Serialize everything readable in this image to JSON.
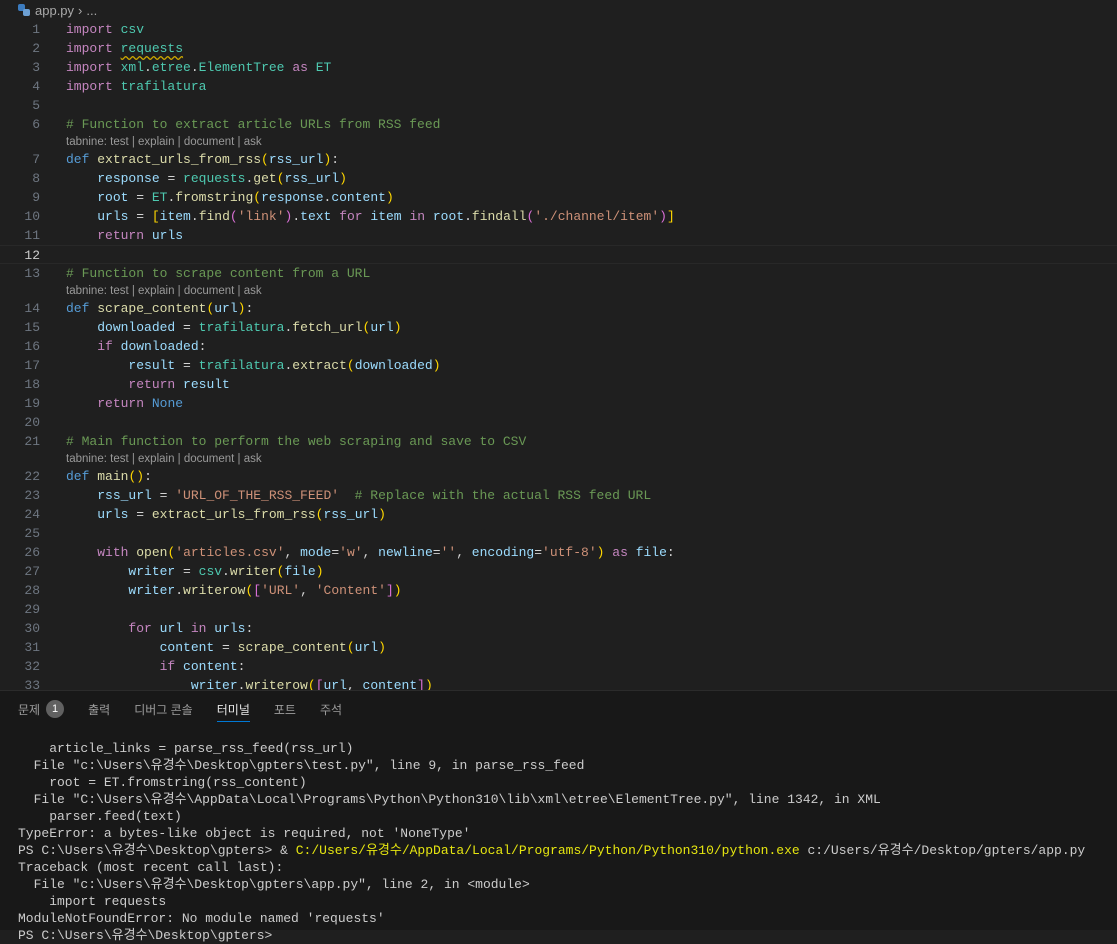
{
  "breadcrumb": {
    "file": "app.py",
    "more": "..."
  },
  "codelens": "tabnine: test | explain | document | ask",
  "current_line": 12,
  "code": [
    {
      "n": 1,
      "t": [
        [
          "k",
          "import"
        ],
        [
          "p",
          " "
        ],
        [
          "m",
          "csv"
        ]
      ]
    },
    {
      "n": 2,
      "t": [
        [
          "k",
          "import"
        ],
        [
          "p",
          " "
        ],
        [
          "m sq",
          "requests"
        ]
      ]
    },
    {
      "n": 3,
      "t": [
        [
          "k",
          "import"
        ],
        [
          "p",
          " "
        ],
        [
          "m",
          "xml"
        ],
        [
          "p",
          "."
        ],
        [
          "m",
          "etree"
        ],
        [
          "p",
          "."
        ],
        [
          "m",
          "ElementTree"
        ],
        [
          "p",
          " "
        ],
        [
          "k",
          "as"
        ],
        [
          "p",
          " "
        ],
        [
          "m",
          "ET"
        ]
      ]
    },
    {
      "n": 4,
      "t": [
        [
          "k",
          "import"
        ],
        [
          "p",
          " "
        ],
        [
          "m",
          "trafilatura"
        ]
      ]
    },
    {
      "n": 5,
      "t": []
    },
    {
      "n": 6,
      "t": [
        [
          "c",
          "# Function to extract article URLs from RSS feed"
        ]
      ]
    },
    {
      "n": 7,
      "lens": true,
      "t": [
        [
          "d",
          "def"
        ],
        [
          "p",
          " "
        ],
        [
          "f",
          "extract_urls_from_rss"
        ],
        [
          "b1",
          "("
        ],
        [
          "v",
          "rss_url"
        ],
        [
          "b1",
          ")"
        ],
        [
          "p",
          ":"
        ]
      ]
    },
    {
      "n": 8,
      "t": [
        [
          "p",
          "    "
        ],
        [
          "v",
          "response"
        ],
        [
          "p",
          " = "
        ],
        [
          "m",
          "requests"
        ],
        [
          "p",
          "."
        ],
        [
          "f",
          "get"
        ],
        [
          "b1",
          "("
        ],
        [
          "v",
          "rss_url"
        ],
        [
          "b1",
          ")"
        ]
      ]
    },
    {
      "n": 9,
      "t": [
        [
          "p",
          "    "
        ],
        [
          "v",
          "root"
        ],
        [
          "p",
          " = "
        ],
        [
          "m",
          "ET"
        ],
        [
          "p",
          "."
        ],
        [
          "f",
          "fromstring"
        ],
        [
          "b1",
          "("
        ],
        [
          "v",
          "response"
        ],
        [
          "p",
          "."
        ],
        [
          "v",
          "content"
        ],
        [
          "b1",
          ")"
        ]
      ]
    },
    {
      "n": 10,
      "t": [
        [
          "p",
          "    "
        ],
        [
          "v",
          "urls"
        ],
        [
          "p",
          " = "
        ],
        [
          "b1",
          "["
        ],
        [
          "v",
          "item"
        ],
        [
          "p",
          "."
        ],
        [
          "f",
          "find"
        ],
        [
          "b2",
          "("
        ],
        [
          "s",
          "'link'"
        ],
        [
          "b2",
          ")"
        ],
        [
          "p",
          "."
        ],
        [
          "v",
          "text"
        ],
        [
          "p",
          " "
        ],
        [
          "k",
          "for"
        ],
        [
          "p",
          " "
        ],
        [
          "v",
          "item"
        ],
        [
          "p",
          " "
        ],
        [
          "k",
          "in"
        ],
        [
          "p",
          " "
        ],
        [
          "v",
          "root"
        ],
        [
          "p",
          "."
        ],
        [
          "f",
          "findall"
        ],
        [
          "b2",
          "("
        ],
        [
          "s",
          "'./channel/item'"
        ],
        [
          "b2",
          ")"
        ],
        [
          "b1",
          "]"
        ]
      ]
    },
    {
      "n": 11,
      "t": [
        [
          "p",
          "    "
        ],
        [
          "k",
          "return"
        ],
        [
          "p",
          " "
        ],
        [
          "v",
          "urls"
        ]
      ]
    },
    {
      "n": 12,
      "t": []
    },
    {
      "n": 13,
      "t": [
        [
          "c",
          "# Function to scrape content from a URL"
        ]
      ]
    },
    {
      "n": 14,
      "lens": true,
      "t": [
        [
          "d",
          "def"
        ],
        [
          "p",
          " "
        ],
        [
          "f",
          "scrape_content"
        ],
        [
          "b1",
          "("
        ],
        [
          "v",
          "url"
        ],
        [
          "b1",
          ")"
        ],
        [
          "p",
          ":"
        ]
      ]
    },
    {
      "n": 15,
      "t": [
        [
          "p",
          "    "
        ],
        [
          "v",
          "downloaded"
        ],
        [
          "p",
          " = "
        ],
        [
          "m",
          "trafilatura"
        ],
        [
          "p",
          "."
        ],
        [
          "f",
          "fetch_url"
        ],
        [
          "b1",
          "("
        ],
        [
          "v",
          "url"
        ],
        [
          "b1",
          ")"
        ]
      ]
    },
    {
      "n": 16,
      "t": [
        [
          "p",
          "    "
        ],
        [
          "k",
          "if"
        ],
        [
          "p",
          " "
        ],
        [
          "v",
          "downloaded"
        ],
        [
          "p",
          ":"
        ]
      ]
    },
    {
      "n": 17,
      "t": [
        [
          "p",
          "        "
        ],
        [
          "v",
          "result"
        ],
        [
          "p",
          " = "
        ],
        [
          "m",
          "trafilatura"
        ],
        [
          "p",
          "."
        ],
        [
          "f",
          "extract"
        ],
        [
          "b1",
          "("
        ],
        [
          "v",
          "downloaded"
        ],
        [
          "b1",
          ")"
        ]
      ]
    },
    {
      "n": 18,
      "t": [
        [
          "p",
          "        "
        ],
        [
          "k",
          "return"
        ],
        [
          "p",
          " "
        ],
        [
          "v",
          "result"
        ]
      ]
    },
    {
      "n": 19,
      "t": [
        [
          "p",
          "    "
        ],
        [
          "k",
          "return"
        ],
        [
          "p",
          " "
        ],
        [
          "d",
          "None"
        ]
      ]
    },
    {
      "n": 20,
      "t": []
    },
    {
      "n": 21,
      "t": [
        [
          "c",
          "# Main function to perform the web scraping and save to CSV"
        ]
      ]
    },
    {
      "n": 22,
      "lens": true,
      "t": [
        [
          "d",
          "def"
        ],
        [
          "p",
          " "
        ],
        [
          "f",
          "main"
        ],
        [
          "b1",
          "("
        ],
        [
          "b1",
          ")"
        ],
        [
          "p",
          ":"
        ]
      ]
    },
    {
      "n": 23,
      "t": [
        [
          "p",
          "    "
        ],
        [
          "v",
          "rss_url"
        ],
        [
          "p",
          " = "
        ],
        [
          "s",
          "'URL_OF_THE_RSS_FEED'"
        ],
        [
          "p",
          "  "
        ],
        [
          "c",
          "# Replace with the actual RSS feed URL"
        ]
      ]
    },
    {
      "n": 24,
      "t": [
        [
          "p",
          "    "
        ],
        [
          "v",
          "urls"
        ],
        [
          "p",
          " = "
        ],
        [
          "f",
          "extract_urls_from_rss"
        ],
        [
          "b1",
          "("
        ],
        [
          "v",
          "rss_url"
        ],
        [
          "b1",
          ")"
        ]
      ]
    },
    {
      "n": 25,
      "t": []
    },
    {
      "n": 26,
      "t": [
        [
          "p",
          "    "
        ],
        [
          "k",
          "with"
        ],
        [
          "p",
          " "
        ],
        [
          "f",
          "open"
        ],
        [
          "b1",
          "("
        ],
        [
          "s",
          "'articles.csv'"
        ],
        [
          "p",
          ", "
        ],
        [
          "v",
          "mode"
        ],
        [
          "p",
          "="
        ],
        [
          "s",
          "'w'"
        ],
        [
          "p",
          ", "
        ],
        [
          "v",
          "newline"
        ],
        [
          "p",
          "="
        ],
        [
          "s",
          "''"
        ],
        [
          "p",
          ", "
        ],
        [
          "v",
          "encoding"
        ],
        [
          "p",
          "="
        ],
        [
          "s",
          "'utf-8'"
        ],
        [
          "b1",
          ")"
        ],
        [
          "p",
          " "
        ],
        [
          "k",
          "as"
        ],
        [
          "p",
          " "
        ],
        [
          "v",
          "file"
        ],
        [
          "p",
          ":"
        ]
      ]
    },
    {
      "n": 27,
      "t": [
        [
          "p",
          "        "
        ],
        [
          "v",
          "writer"
        ],
        [
          "p",
          " = "
        ],
        [
          "m",
          "csv"
        ],
        [
          "p",
          "."
        ],
        [
          "f",
          "writer"
        ],
        [
          "b1",
          "("
        ],
        [
          "v",
          "file"
        ],
        [
          "b1",
          ")"
        ]
      ]
    },
    {
      "n": 28,
      "t": [
        [
          "p",
          "        "
        ],
        [
          "v",
          "writer"
        ],
        [
          "p",
          "."
        ],
        [
          "f",
          "writerow"
        ],
        [
          "b1",
          "("
        ],
        [
          "b2",
          "["
        ],
        [
          "s",
          "'URL'"
        ],
        [
          "p",
          ", "
        ],
        [
          "s",
          "'Content'"
        ],
        [
          "b2",
          "]"
        ],
        [
          "b1",
          ")"
        ]
      ]
    },
    {
      "n": 29,
      "t": []
    },
    {
      "n": 30,
      "t": [
        [
          "p",
          "        "
        ],
        [
          "k",
          "for"
        ],
        [
          "p",
          " "
        ],
        [
          "v",
          "url"
        ],
        [
          "p",
          " "
        ],
        [
          "k",
          "in"
        ],
        [
          "p",
          " "
        ],
        [
          "v",
          "urls"
        ],
        [
          "p",
          ":"
        ]
      ]
    },
    {
      "n": 31,
      "t": [
        [
          "p",
          "            "
        ],
        [
          "v",
          "content"
        ],
        [
          "p",
          " = "
        ],
        [
          "f",
          "scrape_content"
        ],
        [
          "b1",
          "("
        ],
        [
          "v",
          "url"
        ],
        [
          "b1",
          ")"
        ]
      ]
    },
    {
      "n": 32,
      "t": [
        [
          "p",
          "            "
        ],
        [
          "k",
          "if"
        ],
        [
          "p",
          " "
        ],
        [
          "v",
          "content"
        ],
        [
          "p",
          ":"
        ]
      ]
    },
    {
      "n": 33,
      "t": [
        [
          "p",
          "                "
        ],
        [
          "v",
          "writer"
        ],
        [
          "p",
          "."
        ],
        [
          "f",
          "writerow"
        ],
        [
          "b1",
          "("
        ],
        [
          "b2",
          "["
        ],
        [
          "v",
          "url"
        ],
        [
          "p",
          ", "
        ],
        [
          "v",
          "content"
        ],
        [
          "b2",
          "]"
        ],
        [
          "b1",
          ")"
        ]
      ]
    }
  ],
  "panel": {
    "tabs": [
      {
        "label": "문제",
        "badge": "1"
      },
      {
        "label": "출력"
      },
      {
        "label": "디버그 콘솔"
      },
      {
        "label": "터미널",
        "active": true
      },
      {
        "label": "포트"
      },
      {
        "label": "주석"
      }
    ],
    "terminal": [
      [
        [
          "",
          "    article_links = parse_rss_feed(rss_url)"
        ]
      ],
      [
        [
          "",
          "  File \"c:\\Users\\유경수\\Desktop\\gpters\\test.py\", line 9, in parse_rss_feed"
        ]
      ],
      [
        [
          "",
          "    root = ET.fromstring(rss_content)"
        ]
      ],
      [
        [
          "",
          "  File \"C:\\Users\\유경수\\AppData\\Local\\Programs\\Python\\Python310\\lib\\xml\\etree\\ElementTree.py\", line 1342, in XML"
        ]
      ],
      [
        [
          "",
          "    parser.feed(text)"
        ]
      ],
      [
        [
          "",
          "TypeError: a bytes-like object is required, not 'NoneType'"
        ]
      ],
      [
        [
          "",
          "PS C:\\Users\\유경수\\Desktop\\gpters> & "
        ],
        [
          "y",
          "C:/Users/유경수/AppData/Local/Programs/Python/Python310/python.exe"
        ],
        [
          "",
          " c:/Users/유경수/Desktop/gpters/app.py"
        ]
      ],
      [
        [
          "",
          "Traceback (most recent call last):"
        ]
      ],
      [
        [
          "",
          "  File \"c:\\Users\\유경수\\Desktop\\gpters\\app.py\", line 2, in <module>"
        ]
      ],
      [
        [
          "",
          "    import requests"
        ]
      ],
      [
        [
          "",
          "ModuleNotFoundError: No module named 'requests'"
        ]
      ],
      [
        [
          "",
          "PS C:\\Users\\유경수\\Desktop\\gpters>"
        ]
      ]
    ]
  }
}
